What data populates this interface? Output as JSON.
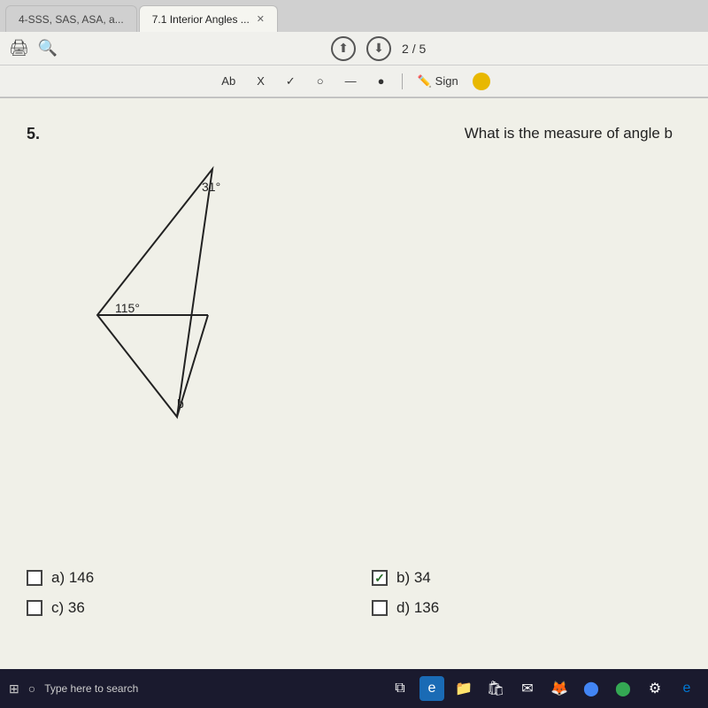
{
  "browser": {
    "tabs": [
      {
        "label": "4-SSS, SAS, ASA, a...",
        "active": false
      },
      {
        "label": "7.1 Interior Angles ...",
        "active": true
      }
    ],
    "page_current": "2",
    "page_total": "5",
    "page_separator": "/"
  },
  "toolbar": {
    "ab_label": "Ab",
    "x_label": "X",
    "check_label": "✓",
    "circle_label": "○",
    "dash_label": "—",
    "dot_label": "●",
    "sign_label": "Sign",
    "up_arrow": "⬆",
    "down_arrow": "⬇"
  },
  "question": {
    "number": "5.",
    "text": "What is the measure of angle b",
    "angle1_label": "31°",
    "angle2_label": "115°",
    "angle3_label": "b"
  },
  "answers": [
    {
      "id": "a",
      "label": "a)",
      "value": "146",
      "checked": false
    },
    {
      "id": "b",
      "label": "b)",
      "value": "34",
      "checked": true
    },
    {
      "id": "c",
      "label": "c)",
      "value": "36",
      "checked": false
    },
    {
      "id": "d",
      "label": "d)",
      "value": "136",
      "checked": false
    }
  ],
  "taskbar": {
    "search_placeholder": "Type here to search",
    "search_icon": "🔍"
  }
}
